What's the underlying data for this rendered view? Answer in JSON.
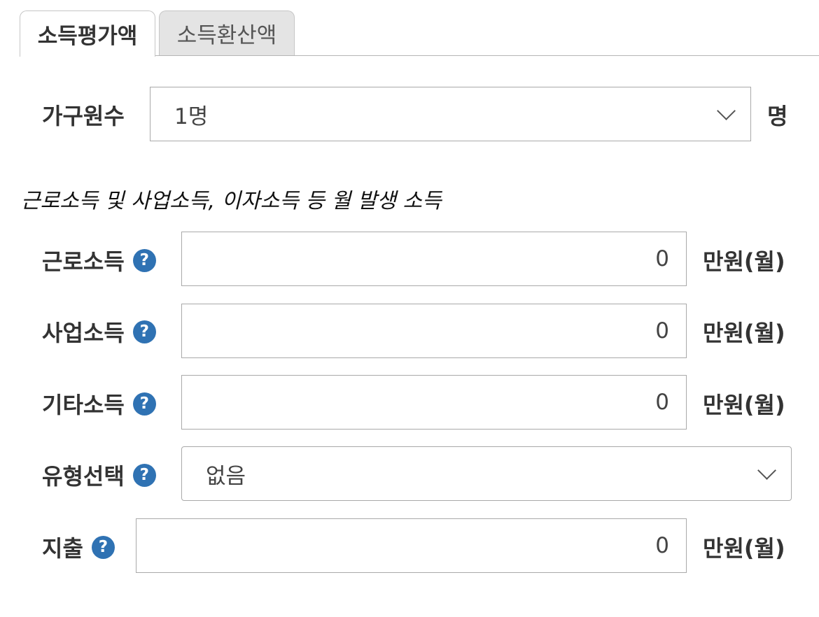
{
  "tabs": [
    {
      "label": "소득평가액",
      "active": true
    },
    {
      "label": "소득환산액",
      "active": false
    }
  ],
  "household": {
    "label": "가구원수",
    "selected": "1명",
    "unit": "명"
  },
  "section_note": "근로소득 및 사업소득, 이자소득 등 월 발생 소득",
  "help_glyph": "?",
  "rows": [
    {
      "label": "근로소득",
      "value": "0",
      "unit": "만원(월)"
    },
    {
      "label": "사업소득",
      "value": "0",
      "unit": "만원(월)"
    },
    {
      "label": "기타소득",
      "value": "0",
      "unit": "만원(월)"
    }
  ],
  "type_select": {
    "label": "유형선택",
    "selected": "없음"
  },
  "expense": {
    "label": "지출",
    "value": "0",
    "unit": "만원(월)"
  },
  "colors": {
    "help_icon": "#2f72b3",
    "inactive_tab": "#e4e4e4",
    "border": "#a9a9a9"
  }
}
